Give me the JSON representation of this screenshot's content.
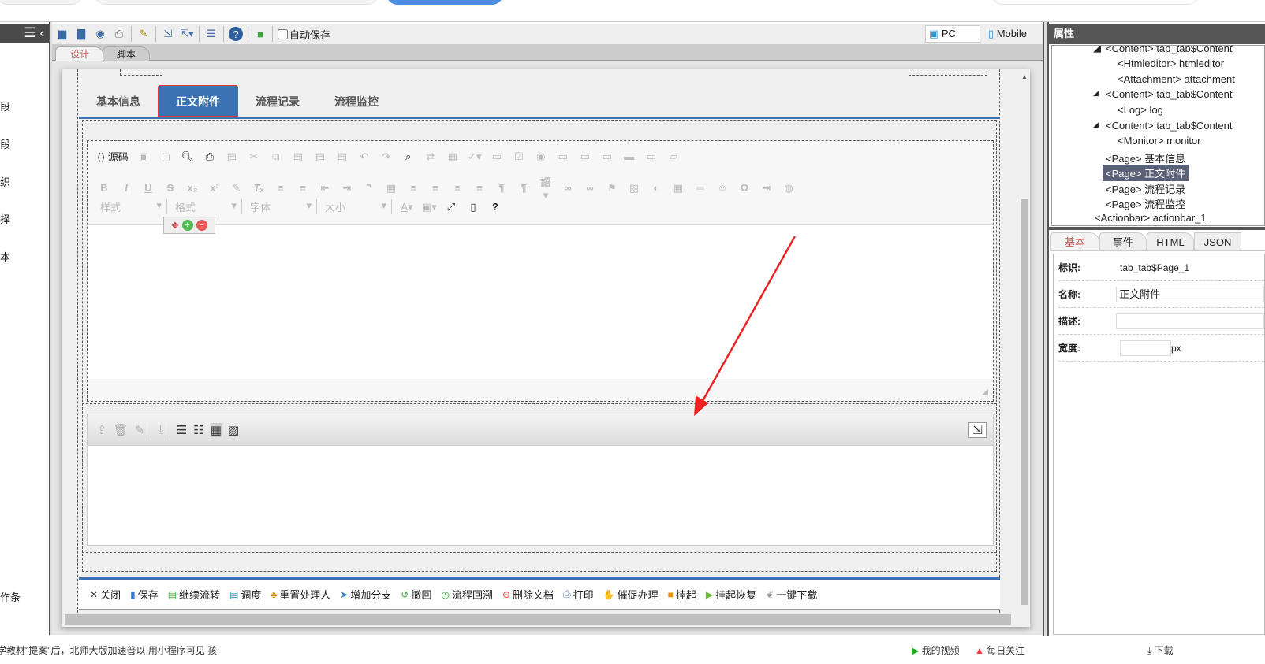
{
  "left_sidebar": {
    "chars": [
      "段",
      "段",
      "织",
      "择",
      "本",
      "作条"
    ]
  },
  "toolbar": {
    "autosave_label": "自动保存",
    "pc_label": "PC",
    "mobile_label": "Mobile"
  },
  "design_tabs": [
    {
      "label": "设计",
      "active": true
    },
    {
      "label": "脚本",
      "active": false
    }
  ],
  "page_tabs": [
    {
      "label": "基本信息"
    },
    {
      "label": "正文附件",
      "active": true
    },
    {
      "label": "流程记录"
    },
    {
      "label": "流程监控"
    }
  ],
  "editor": {
    "source_label": "源码",
    "selects": [
      "样式",
      "格式",
      "字体",
      "大小"
    ]
  },
  "actionbar": [
    {
      "icon": "close-icon",
      "label": "关闭"
    },
    {
      "icon": "save-icon",
      "label": "保存"
    },
    {
      "icon": "forward-icon",
      "label": "继续流转"
    },
    {
      "icon": "dispatch-icon",
      "label": "调度"
    },
    {
      "icon": "reassign-icon",
      "label": "重置处理人"
    },
    {
      "icon": "branch-icon",
      "label": "增加分支"
    },
    {
      "icon": "undo-icon",
      "label": "撤回"
    },
    {
      "icon": "rollback-icon",
      "label": "流程回溯"
    },
    {
      "icon": "delete-icon",
      "label": "删除文档"
    },
    {
      "icon": "print-icon",
      "label": "打印"
    },
    {
      "icon": "urge-icon",
      "label": "催促办理"
    },
    {
      "icon": "pause-icon",
      "label": "挂起"
    },
    {
      "icon": "resume-icon",
      "label": "挂起恢复"
    },
    {
      "icon": "download-icon",
      "label": "一键下载"
    }
  ],
  "right_panel": {
    "title": "属性",
    "tree": [
      "<Content> tab_tab$Content",
      "<Htmleditor> htmleditor",
      "<Attachment> attachment",
      "<Content> tab_tab$Content",
      "<Log> log",
      "<Content> tab_tab$Content",
      "<Monitor> monitor",
      "<Page> 基本信息",
      "<Page> 正文附件",
      "<Page> 流程记录",
      "<Page> 流程监控",
      "<Actionbar> actionbar_1"
    ],
    "tabs": [
      "基本",
      "事件",
      "HTML",
      "JSON"
    ],
    "props": {
      "id_label": "标识:",
      "id_value": "tab_tab$Page_1",
      "name_label": "名称:",
      "name_value": "正文附件",
      "desc_label": "描述:",
      "desc_value": "",
      "width_label": "宽度:",
      "width_value": "",
      "width_unit": "px"
    }
  },
  "bottom_bar": {
    "left_text": "学教材\"提案\"后，北师大版加速普以   用小程序可见   孩",
    "right_items": [
      "我的视频",
      "每日关注",
      "下载"
    ]
  },
  "colors": {
    "accent": "#3a72b4",
    "arrow": "#ee2222",
    "header_dark": "#555555"
  }
}
